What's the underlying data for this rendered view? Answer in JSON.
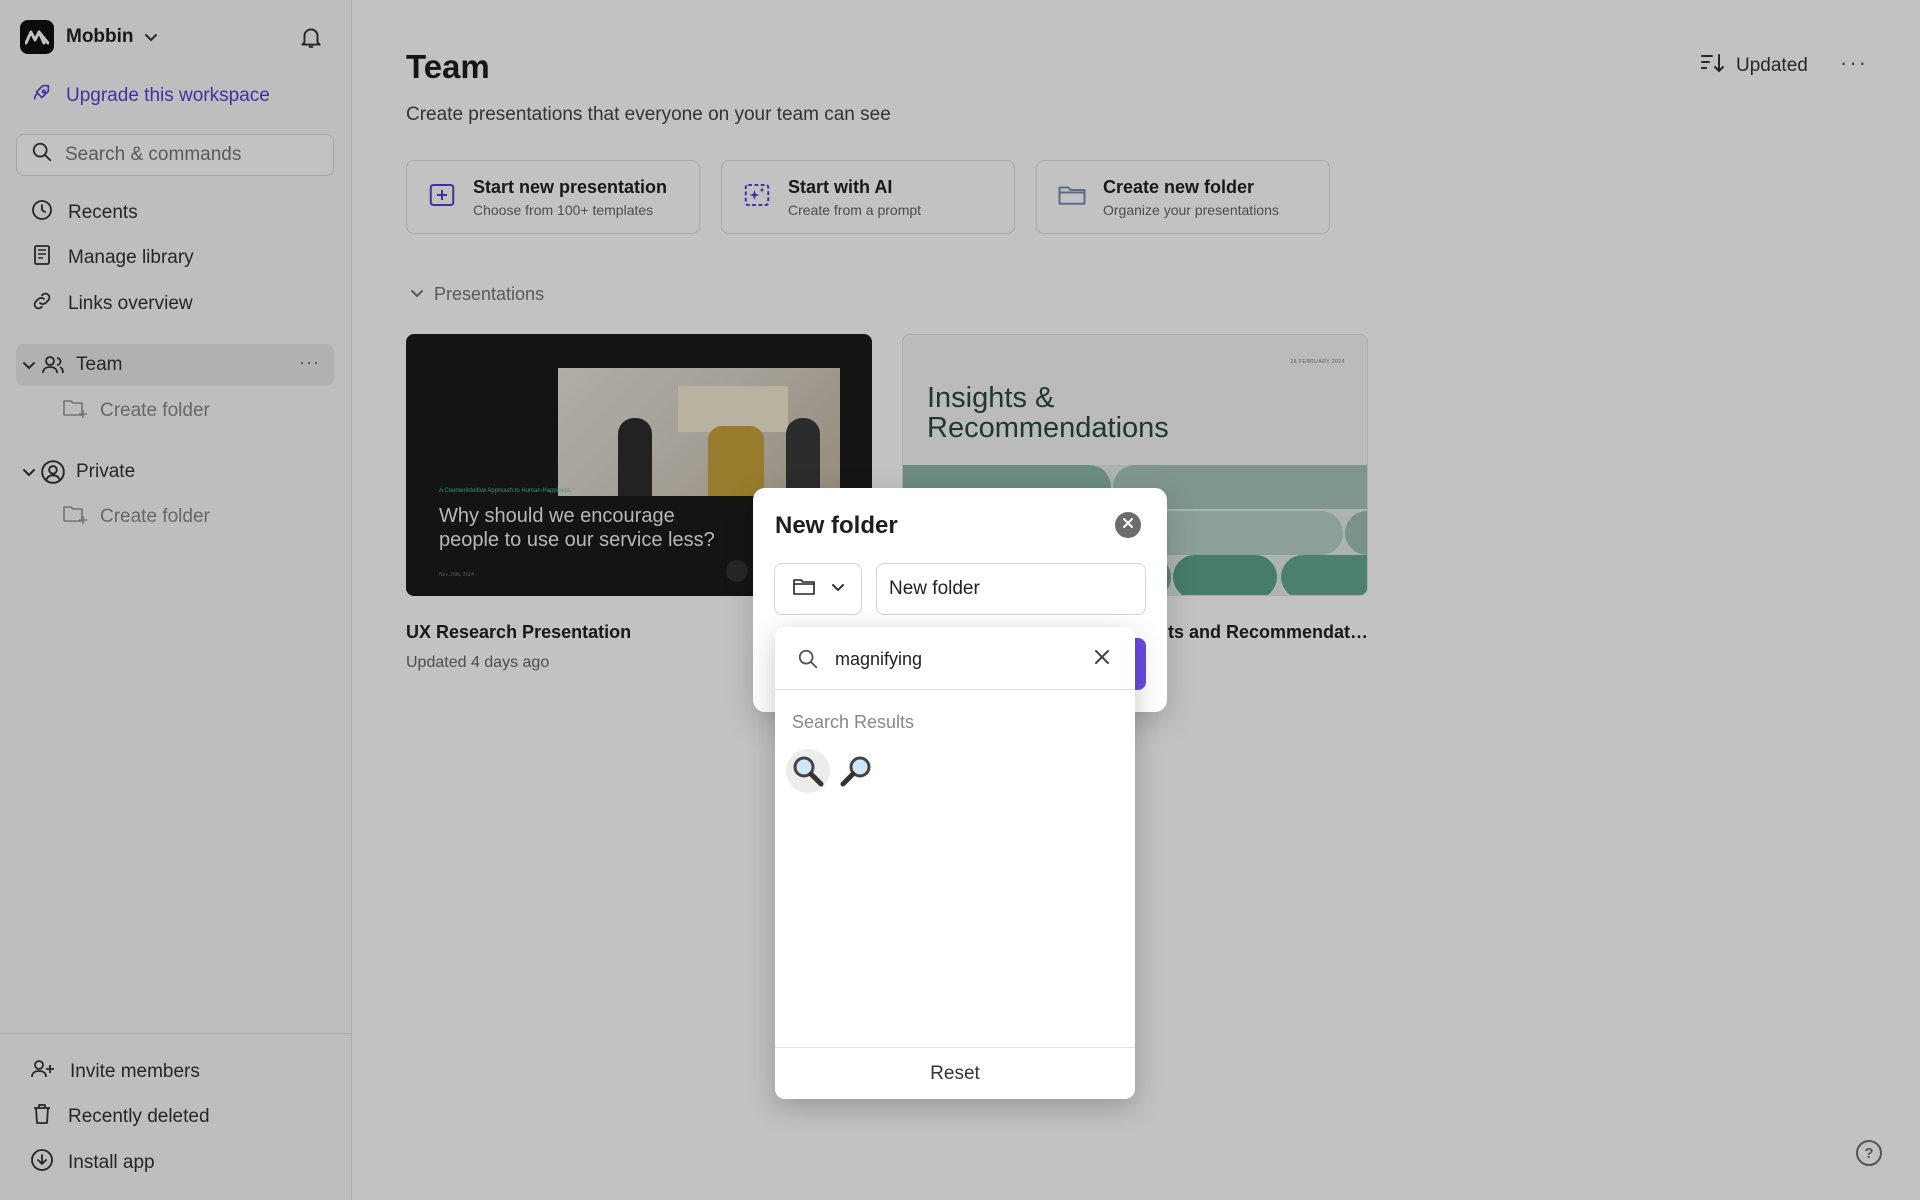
{
  "workspace": {
    "name": "Mobbin"
  },
  "sidebar": {
    "upgrade_label": "Upgrade this workspace",
    "search_placeholder": "Search & commands",
    "nav": [
      {
        "label": "Recents",
        "icon": "clock-icon"
      },
      {
        "label": "Manage library",
        "icon": "book-icon"
      },
      {
        "label": "Links overview",
        "icon": "link-icon"
      }
    ],
    "team": {
      "label": "Team",
      "more": "···",
      "create_folder": "Create folder"
    },
    "private": {
      "label": "Private",
      "create_folder": "Create folder"
    },
    "bottom": [
      {
        "label": "Invite members",
        "icon": "user-plus-icon"
      },
      {
        "label": "Recently deleted",
        "icon": "trash-icon"
      },
      {
        "label": "Install app",
        "icon": "download-icon"
      }
    ]
  },
  "main": {
    "title": "Team",
    "subtitle": "Create presentations that everyone on your team can see",
    "sort_label": "Updated",
    "more": "···",
    "actions": [
      {
        "title": "Start new presentation",
        "subtitle": "Choose from 100+ templates",
        "icon": "plus-square-icon"
      },
      {
        "title": "Start with AI",
        "subtitle": "Create from a prompt",
        "icon": "sparkle-icon"
      },
      {
        "title": "Create new folder",
        "subtitle": "Organize your presentations",
        "icon": "folder-icon"
      }
    ],
    "section_label": "Presentations",
    "presentations": [
      {
        "title": "UX Research Presentation",
        "meta": "Updated 4 days ago",
        "thumb_kicker": "A Counterintuitive Approach to Human Happiness",
        "thumb_headline": "Why should we encourage people to use our service less?",
        "thumb_foot": "Nov. 20th, 2024"
      },
      {
        "title": "Insights and Recommendat…",
        "thumb_date": "28 FEBRUARY 2024",
        "thumb_heading_1": "Insights &",
        "thumb_heading_2": "Recommendations"
      }
    ]
  },
  "dialog": {
    "title": "New folder",
    "name_value": "New folder",
    "emoji_search": {
      "query": "magnifying",
      "results_heading": "Search Results",
      "results": [
        "🔍",
        "🔎"
      ],
      "reset_label": "Reset"
    }
  },
  "help": {
    "label": "?"
  },
  "colors": {
    "accent": "#5b3fd4",
    "create_button": "#6b4be0",
    "overlay": "#000000"
  }
}
